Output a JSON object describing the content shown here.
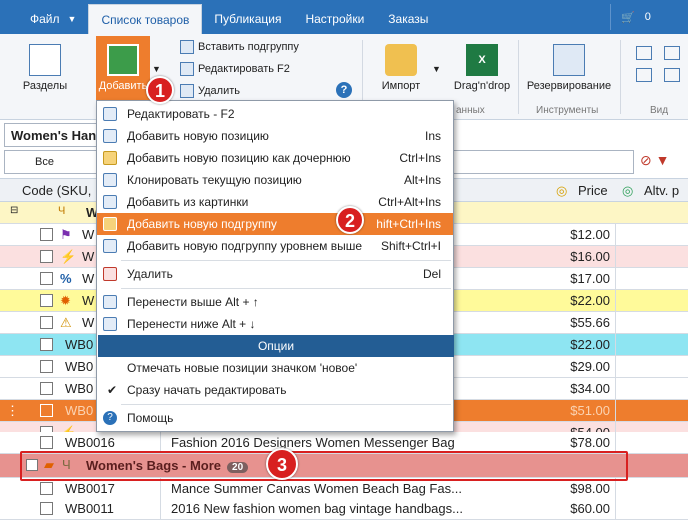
{
  "menubar": {
    "tabs": [
      {
        "label": "Файл"
      },
      {
        "label": "Список товаров"
      },
      {
        "label": "Публикация"
      },
      {
        "label": "Настройки"
      },
      {
        "label": "Заказы"
      }
    ]
  },
  "cart": {
    "count": "0"
  },
  "ribbon": {
    "sections_label": "Разделы",
    "add_label": "Добавить",
    "insert_subgroup": "Вставить подгруппу",
    "edit_label": "Редактировать F2",
    "delete_label": "Удалить",
    "import_label": "Импорт",
    "dragdrop_label": "Drag'n'drop",
    "backup_label": "Резервирование",
    "tools_group": "Инструменты",
    "view_group": "Вид",
    "data_group": "анных"
  },
  "category_combo": {
    "value": "Women's Han"
  },
  "filter": {
    "value": "Все"
  },
  "columns": {
    "code": "Code (SKU,",
    "price": "Price",
    "alt": "Altv. p"
  },
  "rows": [
    {
      "code": "W",
      "name": "",
      "price": ""
    },
    {
      "code": "W",
      "name": "",
      "price": "$12.00"
    },
    {
      "code": "W",
      "name": "",
      "price": "$16.00"
    },
    {
      "code": "W",
      "name": "",
      "price": "$17.00"
    },
    {
      "code": "W",
      "name": "",
      "price": "$22.00"
    },
    {
      "code": "W",
      "name": "",
      "price": "$55.66"
    },
    {
      "code": "WB0",
      "name": "",
      "price": "$22.00"
    },
    {
      "code": "WB0",
      "name": "",
      "price": "$29.00"
    },
    {
      "code": "WB0",
      "name": "",
      "price": "$34.00"
    },
    {
      "code": "WB0",
      "name": "",
      "price": "$51.00"
    },
    {
      "code": "",
      "name": "",
      "price": "$54.00"
    },
    {
      "code": "WB0016",
      "name": "Fashion 2016 Designers Women Messenger Bag",
      "price": "$78.00"
    },
    {
      "code": "",
      "name": "",
      "price": ""
    },
    {
      "code": "WB0017",
      "name": "Mance Summer Canvas Women Beach Bag Fas...",
      "price": "$98.00"
    },
    {
      "code": "WB0011",
      "name": "2016 New fashion women bag vintage handbags...",
      "price": "$60.00"
    }
  ],
  "group_row": {
    "label": "Women's Bags - More",
    "count": "20"
  },
  "menu": {
    "items": [
      {
        "label": "Редактировать - F2",
        "shortcut": ""
      },
      {
        "label": "Добавить новую позицию",
        "shortcut": "Ins"
      },
      {
        "label": "Добавить новую позицию как дочернюю",
        "shortcut": "Ctrl+Ins"
      },
      {
        "label": "Клонировать текущую позицию",
        "shortcut": "Alt+Ins"
      },
      {
        "label": "Добавить из картинки",
        "shortcut": "Ctrl+Alt+Ins"
      },
      {
        "label": "Добавить новую подгруппу",
        "shortcut": "hift+Ctrl+Ins"
      },
      {
        "label": "Добавить новую подгруппу уровнем выше",
        "shortcut": "Shift+Ctrl+I"
      },
      {
        "label": "Удалить",
        "shortcut": "Del"
      },
      {
        "label": "Перенести выше  Alt + ↑",
        "shortcut": ""
      },
      {
        "label": "Перенести ниже  Alt + ↓",
        "shortcut": ""
      },
      {
        "label": "Отмечать новые позиции значком 'новое'",
        "shortcut": ""
      },
      {
        "label": "Сразу начать редактировать",
        "shortcut": ""
      },
      {
        "label": "Помощь",
        "shortcut": ""
      }
    ],
    "options_header": "Опции"
  },
  "badges": [
    "1",
    "2",
    "3"
  ]
}
